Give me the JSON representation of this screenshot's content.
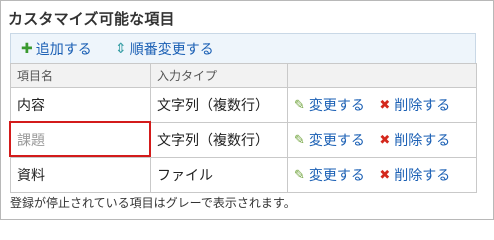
{
  "title": "カスタマイズ可能な項目",
  "toolbar": {
    "add_label": "追加する",
    "reorder_label": "順番変更する"
  },
  "table": {
    "headers": [
      "項目名",
      "入力タイプ",
      ""
    ],
    "rows": [
      {
        "name": "内容",
        "type": "文字列（複数行）",
        "edit": "変更する",
        "delete": "削除する",
        "disabled": false
      },
      {
        "name": "課題",
        "type": "文字列（複数行）",
        "edit": "変更する",
        "delete": "削除する",
        "disabled": true
      },
      {
        "name": "資料",
        "type": "ファイル",
        "edit": "変更する",
        "delete": "削除する",
        "disabled": false
      }
    ]
  },
  "footer_note": "登録が停止されている項目はグレーで表示されます。",
  "colors": {
    "link": "#1a5fb4",
    "highlight": "#d31b1b",
    "disabled_text": "#9a9a9a",
    "add_icon": "#3a9a2f",
    "delete_icon": "#d4281c"
  },
  "icons": {
    "add": "plus-icon",
    "reorder": "sort-arrows-icon",
    "edit": "pencil-icon",
    "delete": "x-icon"
  }
}
